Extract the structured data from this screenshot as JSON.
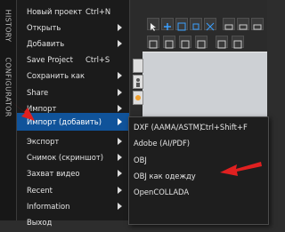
{
  "side_tabs": [
    "HISTORY",
    "CONFIGURATOR"
  ],
  "menu": {
    "items": [
      {
        "label": "Новый проект",
        "shortcut": "Ctrl+N",
        "submenu": false
      },
      {
        "label": "Открыть",
        "shortcut": "",
        "submenu": true
      },
      {
        "label": "Добавить",
        "shortcut": "",
        "submenu": true
      },
      {
        "label": "Save Project",
        "shortcut": "Ctrl+S",
        "submenu": false
      },
      {
        "label": "Сохранить как",
        "shortcut": "",
        "submenu": true
      },
      {
        "label": "Share",
        "shortcut": "",
        "submenu": true
      },
      {
        "label": "Импорт",
        "shortcut": "",
        "submenu": true
      },
      {
        "label": "Импорт (добавить)",
        "shortcut": "",
        "submenu": true,
        "highlighted": true
      },
      {
        "label": "Экспорт",
        "shortcut": "",
        "submenu": true
      },
      {
        "label": "Снимок (скриншот)",
        "shortcut": "",
        "submenu": true
      },
      {
        "label": "Захват видео",
        "shortcut": "",
        "submenu": true
      },
      {
        "label": "Recent",
        "shortcut": "",
        "submenu": true
      },
      {
        "label": "Information",
        "shortcut": "",
        "submenu": true
      },
      {
        "label": "Выход",
        "shortcut": "",
        "submenu": false
      }
    ]
  },
  "submenu": {
    "items": [
      {
        "label": "DXF (AAMA/ASTM)",
        "shortcut": "Ctrl+Shift+F"
      },
      {
        "label": "Adobe (AI/PDF)",
        "shortcut": ""
      },
      {
        "label": "OBJ",
        "shortcut": ""
      },
      {
        "label": "OBJ как одежду",
        "shortcut": ""
      },
      {
        "label": "OpenCOLLADA",
        "shortcut": ""
      }
    ]
  },
  "colors": {
    "highlight": "#10539a",
    "annotation_arrow": "#e02020",
    "viewport": "#cdd0d4"
  },
  "icons": [
    "arrow-icon",
    "plus-icon",
    "grid-icon",
    "person-icon",
    "bulb-icon"
  ]
}
